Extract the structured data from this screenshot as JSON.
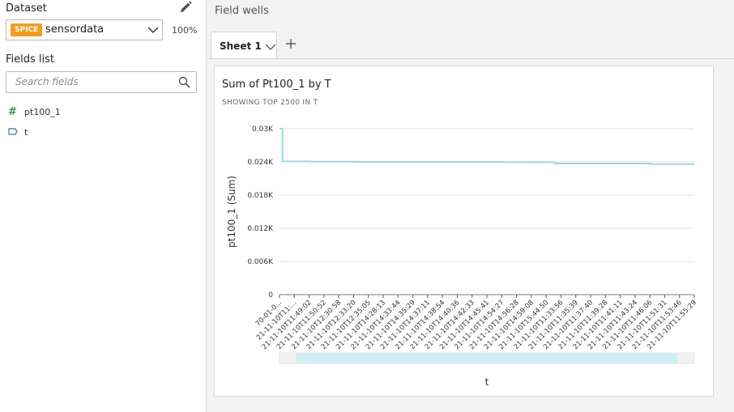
{
  "sidebar": {
    "dataset_label": "Dataset",
    "badge": "SPICE",
    "dataset_name": "sensordata",
    "percent": "100%",
    "fields_label": "Fields list",
    "search_placeholder": "Search fields",
    "fields": [
      {
        "icon": "measure-hash-icon",
        "name": "pt100_1"
      },
      {
        "icon": "dimension-tag-icon",
        "name": "t"
      }
    ]
  },
  "main": {
    "field_wells": "Field wells",
    "tab": "Sheet 1"
  },
  "visual": {
    "title": "Sum of Pt100_1 by T",
    "subtitle": "SHOWING TOP 2500 IN T"
  },
  "colors": {
    "accent": "#f79b1e",
    "line": "#9ed6e5",
    "scroll": "#d3edf4"
  },
  "chart_data": {
    "type": "line",
    "title": "Sum of Pt100_1 by T",
    "xlabel": "t",
    "ylabel": "pt100_1 (Sum)",
    "ytick_labels": [
      "0",
      "0.006K",
      "0.012K",
      "0.018K",
      "0.024K",
      "0.03K"
    ],
    "ylim": [
      0,
      30
    ],
    "x_tick_labels": [
      "70-01-0...",
      "21-11-10T11:...",
      "21-11-10T11:49:02",
      "21-11-10T11:50:52",
      "21-11-10T12:30:58",
      "21-11-10T12:33:20",
      "21-11-10T12:35:05",
      "21-11-10T14:28:13",
      "21-11-10T14:33:44",
      "21-11-10T14:35:29",
      "21-11-10T14:37:11",
      "21-11-10T14:38:54",
      "21-11-10T14:40:36",
      "21-11-10T14:42:33",
      "21-11-10T14:45:41",
      "21-11-10T14:54:27",
      "21-11-10T14:56:28",
      "21-11-10T14:59:08",
      "21-11-10T15:44:50",
      "21-11-10T11:33:56",
      "21-11-10T11:35:39",
      "21-11-10T11:37:40",
      "21-11-10T11:39:28",
      "21-11-10T11:41:11",
      "21-11-10T11:43:24",
      "21-11-10T11:46:06",
      "21-11-10T11:51:31",
      "21-11-10T11:53:46",
      "21-11-10T11:55:29"
    ],
    "series": [
      {
        "x": [
          0,
          0.2,
          1,
          2,
          5,
          10,
          15,
          18.5,
          18.6,
          20,
          25,
          28
        ],
        "values": [
          30,
          24.1,
          24.1,
          24.05,
          24.0,
          24.0,
          23.95,
          23.95,
          23.7,
          23.7,
          23.6,
          23.6
        ]
      }
    ],
    "grid": true,
    "scrollbar": {
      "start": 0.04,
      "end": 0.96
    }
  }
}
